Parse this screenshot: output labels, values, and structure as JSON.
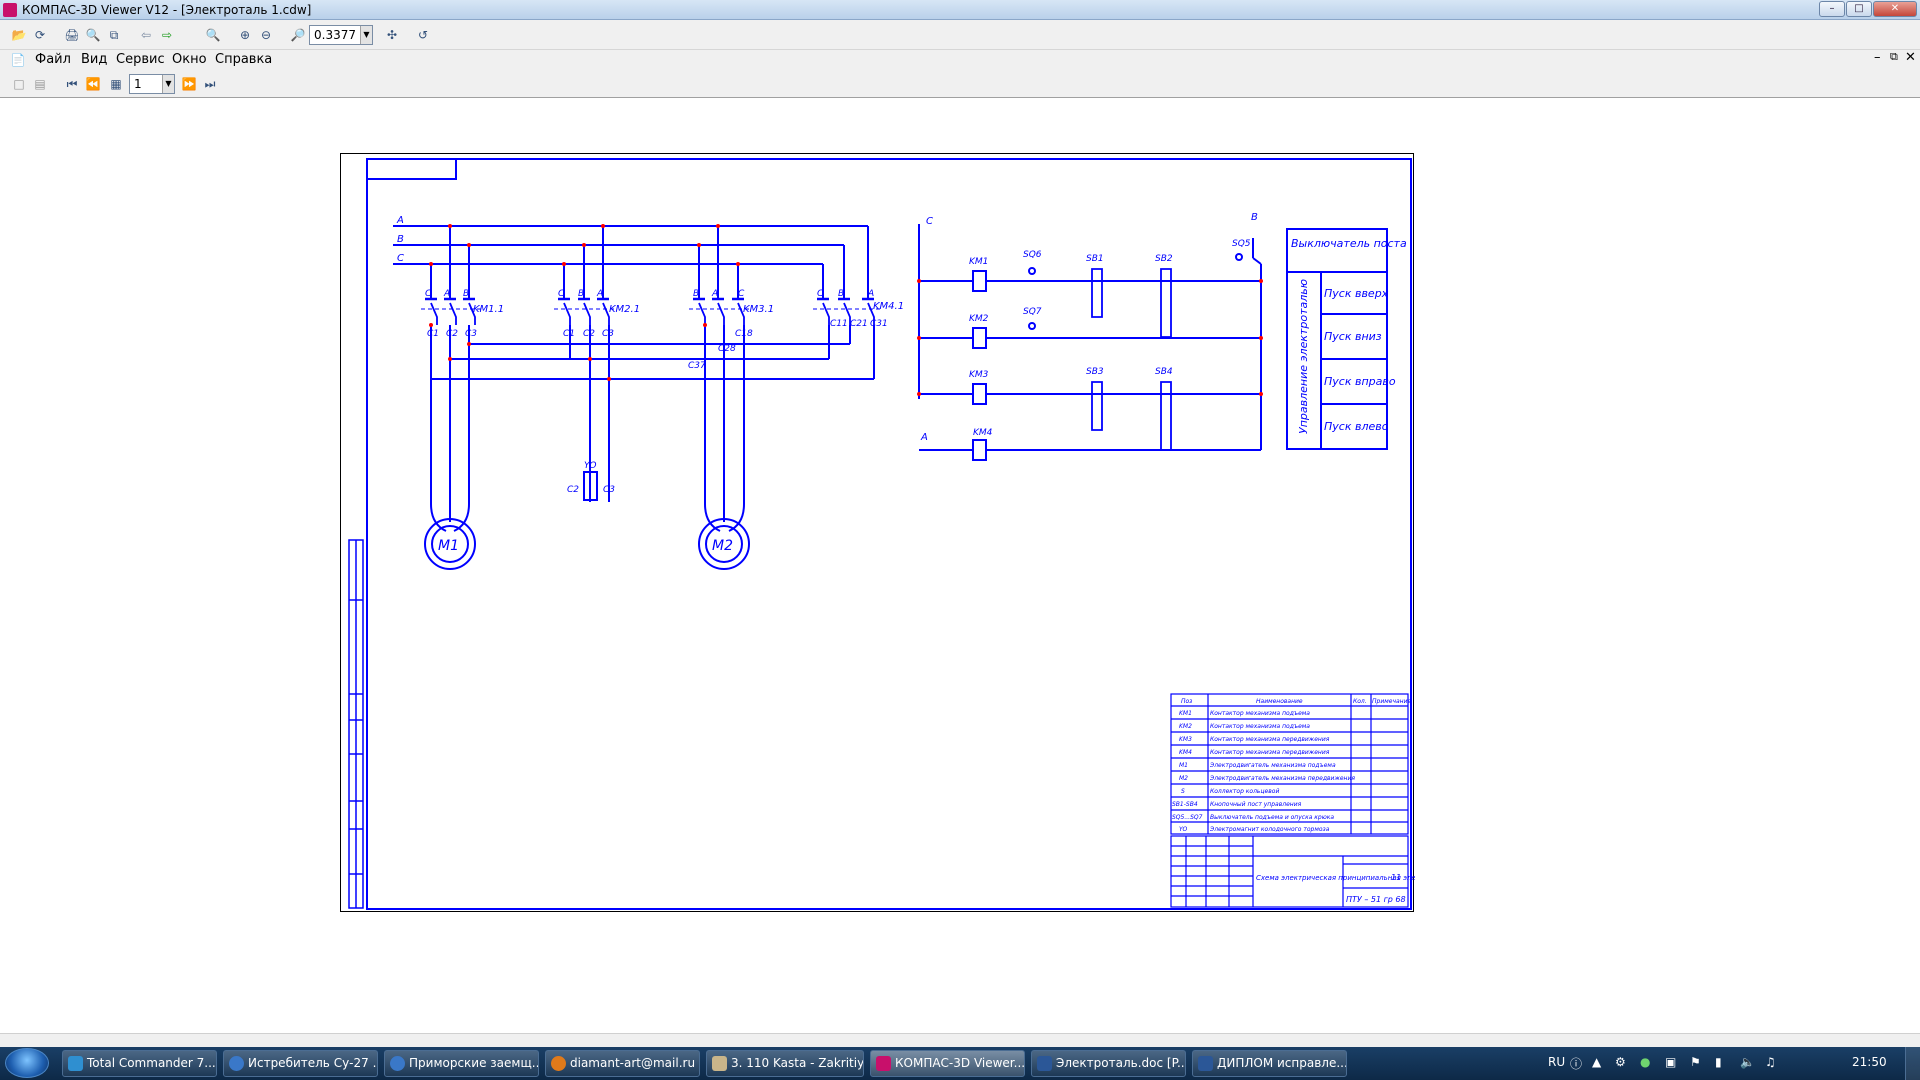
{
  "window": {
    "title": "КОМПАС-3D Viewer V12 - [Электроталь 1.cdw]"
  },
  "toolbar": {
    "zoom_value": "0.3377",
    "page_value": "1"
  },
  "menu": {
    "items": [
      "Файл",
      "Вид",
      "Сервис",
      "Окно",
      "Справка"
    ]
  },
  "schematic": {
    "phases": [
      "A",
      "B",
      "C"
    ],
    "contactors": [
      "KM1.1",
      "KM2.1",
      "KM3.1",
      "KM4.1"
    ],
    "contact_labels": {
      "km1": {
        "top": [
          "C",
          "A",
          "B"
        ],
        "bottom": [
          "C1",
          "C2",
          "C3"
        ]
      },
      "km2": {
        "top": [
          "C",
          "B",
          "A"
        ],
        "bottom": [
          "C1",
          "C2",
          "C3"
        ]
      },
      "km3": {
        "top": [
          "B",
          "A",
          "C"
        ],
        "mid": "C18",
        "bottom": "C37"
      },
      "km4": {
        "top": [
          "C",
          "B",
          "A"
        ],
        "bottom": [
          "C11",
          "C21",
          "C31"
        ]
      }
    },
    "motors": [
      "M1",
      "M2"
    ],
    "brake": {
      "label": "YO",
      "left": "C2",
      "right": "C3"
    },
    "control": {
      "phase_c": "C",
      "phase_a": "A",
      "phase_b": "B",
      "coils": [
        "KM1",
        "KM2",
        "KM3",
        "KM4"
      ],
      "limit_switches": [
        "SQ6",
        "SQ7",
        "SQ5"
      ],
      "buttons": [
        "SB1",
        "SB2",
        "SB3",
        "SB4"
      ]
    },
    "side_table": {
      "header": "Выключатель поста",
      "group": "Управление электроталью",
      "rows": [
        "Пуск вверх",
        "Пуск вниз",
        "Пуск вправо",
        "Пуск влево"
      ]
    }
  },
  "spec_table": {
    "headers": [
      "Поз",
      "Наименование",
      "Кол.",
      "Примечание"
    ],
    "rows": [
      [
        "KM1",
        "Контактор механизма подъема"
      ],
      [
        "KM2",
        "Контактор механизма подъема"
      ],
      [
        "KM3",
        "Контактор механизма передвижения"
      ],
      [
        "KM4",
        "Контактор механизма передвижения"
      ],
      [
        "M1",
        "Электродвигатель механизма подъема"
      ],
      [
        "M2",
        "Электродвигатель механизма передвижения"
      ],
      [
        "S",
        "Коллектор кольцевой"
      ],
      [
        "SB1-SB4",
        "Кнопочный пост управления"
      ],
      [
        "SQ5...SQ7",
        "Выключатель подъема и опуска крюка"
      ],
      [
        "YO",
        "Электромагнит колодочного тормоза"
      ]
    ]
  },
  "title_block": {
    "name": "Схема электрическая принципиальная электротельфера",
    "sheet_no": "11",
    "code": "ПТУ – 51 гр 68"
  },
  "taskbar": {
    "items": [
      "Total Commander 7....",
      "Истребитель Су-27 ...",
      "Приморские заемщ...",
      "diamant-art@mail.ru",
      "3. 110 Kasta - Zakritiy...",
      "КОМПАС-3D Viewer...",
      "Электроталь.doc [P...",
      "ДИПЛОМ исправле..."
    ],
    "lang": "RU",
    "time": "21:50"
  },
  "colors": {
    "line": "#0000ff",
    "node": "#ff0000",
    "accent": "#c8106b"
  }
}
